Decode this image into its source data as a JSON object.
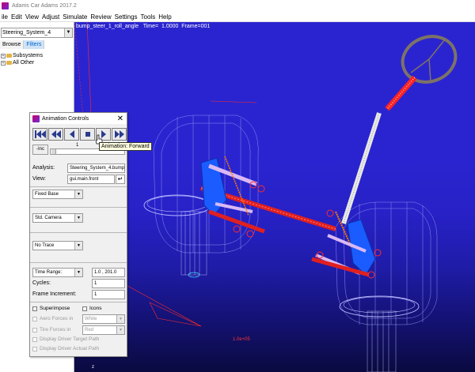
{
  "window": {
    "title": "Adams Car Adams 2017.2"
  },
  "menu": [
    "ile",
    "Edit",
    "View",
    "Adjust",
    "Simulate",
    "Review",
    "Settings",
    "Tools",
    "Help"
  ],
  "browser": {
    "selector": "Steering_System_4",
    "tabs": [
      "Browse",
      "Filters"
    ],
    "tree": [
      "Subsystems",
      "All Other"
    ]
  },
  "viewport": {
    "title_text": "bump_steer_1_roll_angle   Time=  1.0000  Frame=001",
    "scale_label": "1.0e+05",
    "axis_label": "z"
  },
  "animation": {
    "title": "Animation Controls",
    "close": "✕",
    "inc_label": "-Inc",
    "frame_value": "1",
    "tooltip": "Animation: Forward",
    "analysis_label": "Analysis:",
    "analysis_value": "Steering_System_4.bump_",
    "view_label": "View:",
    "view_value": "gui.main.front",
    "base_option": "Fixed Base",
    "camera_option": "Std. Camera",
    "trace_option": "No Trace",
    "time_range_option": "Time Range:",
    "time_range_value": "1.0 , 201.0",
    "cycles_label": "Cycles:",
    "cycles_value": "1",
    "frame_inc_label": "Frame Increment:",
    "frame_inc_value": "1",
    "superimpose_label": "Superimpose",
    "icons_label": "Icons",
    "aero_label": "Aero Forces in",
    "aero_color": "White",
    "tire_label": "Tire Forces in",
    "tire_color": "Red",
    "driver_target_label": "Display Driver Target Path",
    "driver_actual_label": "Display Driver Actual Path"
  },
  "colors": {
    "viewport_blue": "#2a24d0",
    "tooltip_bg": "#ffffe1",
    "accent": "#0066cc"
  }
}
